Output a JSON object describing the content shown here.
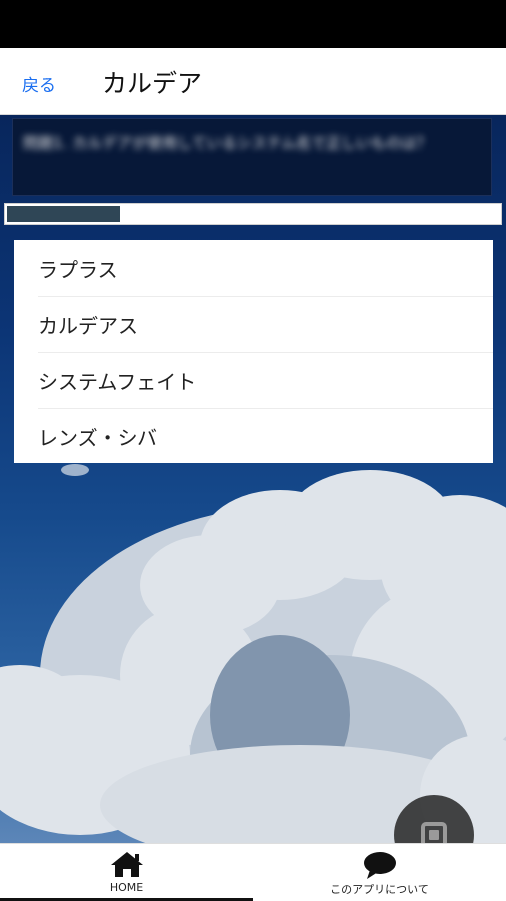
{
  "nav": {
    "back_label": "戻る",
    "title": "カルデア"
  },
  "question": {
    "text": "問題1. カルデアが使用しているシステム名で正しいものは？"
  },
  "progress": {
    "fraction": 0.23
  },
  "answers": [
    {
      "label": "ラプラス"
    },
    {
      "label": "カルデアス"
    },
    {
      "label": "システムフェイト"
    },
    {
      "label": "レンズ・シバ"
    }
  ],
  "tabs": [
    {
      "label": "HOME",
      "icon": "home-icon"
    },
    {
      "label": "このアプリについて",
      "icon": "speech-bubble-icon"
    }
  ],
  "fab": {
    "icon": "stop-square-icon"
  },
  "colors": {
    "accent": "#1a6ef0",
    "sky_top": "#08265c",
    "question_bg": "#071838",
    "progress_fill": "#2f4656"
  }
}
